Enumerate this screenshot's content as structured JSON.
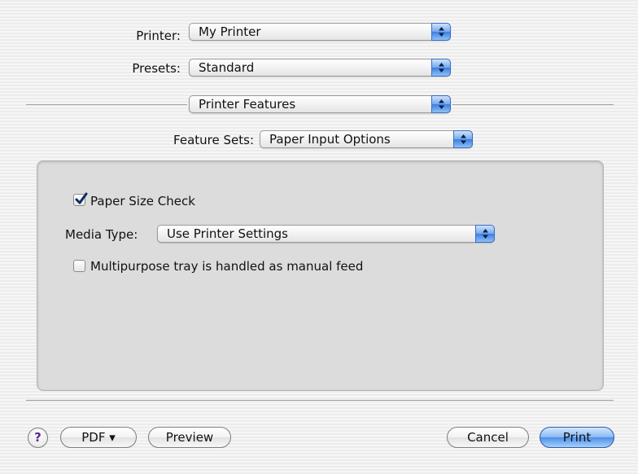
{
  "printer": {
    "label": "Printer:",
    "value": "My Printer"
  },
  "presets": {
    "label": "Presets:",
    "value": "Standard"
  },
  "pane_menu": {
    "value": "Printer Features"
  },
  "feature_sets": {
    "label": "Feature Sets:",
    "value": "Paper Input Options"
  },
  "options": {
    "paper_size_check": {
      "label": "Paper Size Check",
      "checked": true
    },
    "media_type": {
      "label": "Media Type:",
      "value": "Use Printer Settings"
    },
    "multipurpose_tray": {
      "label": "Multipurpose tray is handled as manual feed",
      "checked": false
    }
  },
  "footer": {
    "help_label": "?",
    "pdf_label": "PDF ▾",
    "preview_label": "Preview",
    "cancel_label": "Cancel",
    "print_label": "Print"
  },
  "colors": {
    "accent": "#4d8ee8",
    "panel": "#dcdcdc",
    "help_glyph": "#5b2a8a"
  },
  "icons": {
    "popup_arrows": "updown-arrows-icon",
    "checkmark": "checkmark-icon",
    "help": "help-icon"
  }
}
